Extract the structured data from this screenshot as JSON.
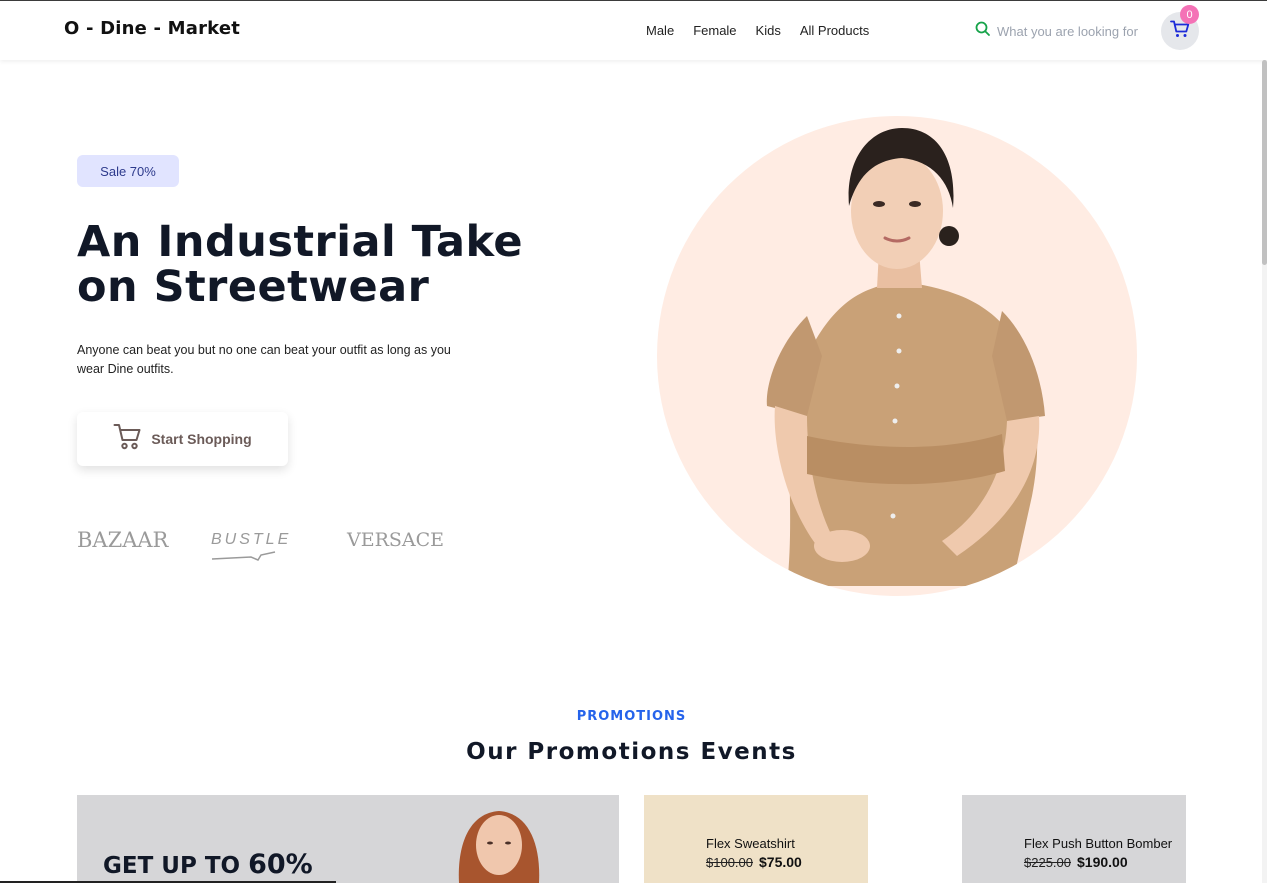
{
  "header": {
    "logo": "O - Dine - Market",
    "nav": [
      "Male",
      "Female",
      "Kids",
      "All Products"
    ],
    "search_placeholder": "What you are looking for",
    "cart_count": "0"
  },
  "hero": {
    "badge": "Sale 70%",
    "title": "An Industrial Take on Streetwear",
    "description": "Anyone can beat you but no one can beat your outfit as long as you wear Dine outfits.",
    "cta_label": "Start Shopping",
    "brands": [
      "BAZAAR",
      "BUSTLE",
      "VERSACE"
    ]
  },
  "promotions": {
    "eyebrow": "PROMOTIONS",
    "title": "Our Promotions Events",
    "banner_prefix": "GET UP TO ",
    "banner_value": "60%",
    "products": [
      {
        "name": "Flex Sweatshirt",
        "old_price": "$100.00",
        "new_price": "$75.00"
      },
      {
        "name": "Flex Push Button Bomber",
        "old_price": "$225.00",
        "new_price": "$190.00"
      }
    ]
  },
  "colors": {
    "accent": "#2563eb",
    "badge_bg": "#e1e4ff",
    "cart_badge": "#f472b6",
    "hero_circle": "#ffece3"
  }
}
